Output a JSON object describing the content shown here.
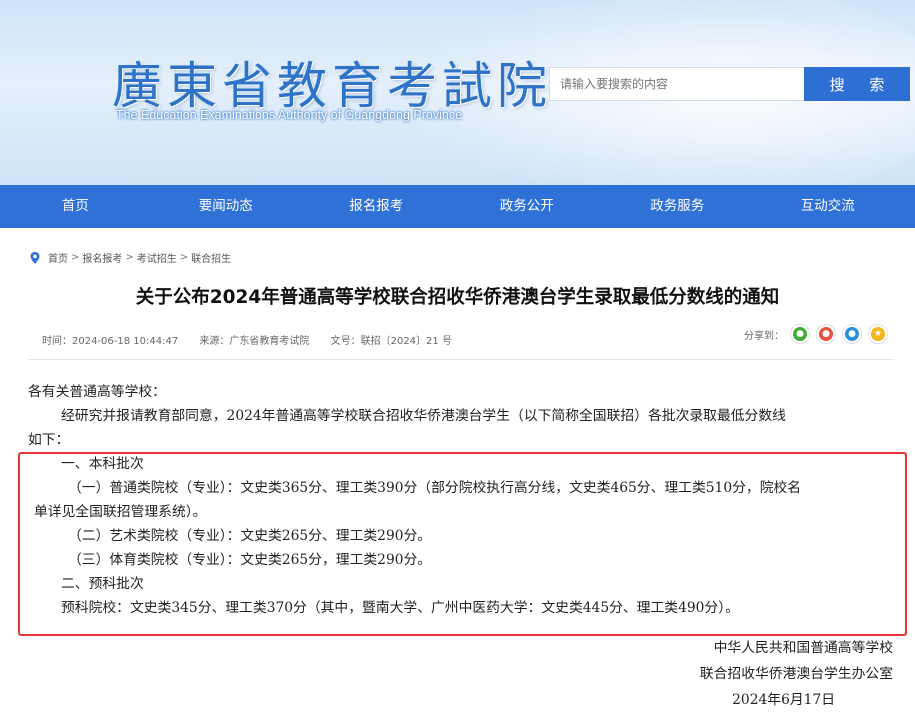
{
  "header": {
    "logo_cn": "廣東省教育考試院",
    "logo_en": "The Education Examinations Authority of Guangdong Province",
    "search_placeholder": "请输入要搜索的内容",
    "search_button": "搜 索"
  },
  "nav": {
    "items": [
      {
        "label": "首页"
      },
      {
        "label": "要闻动态"
      },
      {
        "label": "报名报考"
      },
      {
        "label": "政务公开"
      },
      {
        "label": "政务服务"
      },
      {
        "label": "互动交流"
      }
    ]
  },
  "breadcrumb": {
    "items": [
      "首页",
      "报名报考",
      "考试招生",
      "联合招生"
    ],
    "separator": ">"
  },
  "article": {
    "title": "关于公布2024年普通高等学校联合招收华侨港澳台学生录取最低分数线的通知",
    "meta": {
      "time": "时间：2024-06-18 10:44:47",
      "source": "来源：广东省教育考试院",
      "doc_no": "文号：联招〔2024〕21 号"
    },
    "share_label": "分享到：",
    "share_icons": [
      "wechat-icon",
      "weibo-icon",
      "qq-icon",
      "qzone-icon"
    ],
    "greeting": "各有关普通高等学校：",
    "intro_line1": "经研究并报请教育部同意，2024年普通高等学校联合招收华侨港澳台学生（以下简称全国联招）各批次录取最低分数线",
    "intro_line2": "如下：",
    "section1_title": "一、本科批次",
    "item1_line1": "（一）普通类院校（专业）：文史类365分、理工类390分（部分院校执行高分线，文史类465分、理工类510分，院校名",
    "item1_line2": "单详见全国联招管理系统）。",
    "item2": "（二）艺术类院校（专业）：文史类265分、理工类290分。",
    "item3": "（三）体育类院校（专业）：文史类265分，理工类290分。",
    "section2_title": "二、预科批次",
    "prep_line": "预科院校：文史类345分、理工类370分（其中，暨南大学、广州中医药大学：文史类445分、理工类490分）。",
    "sign_org1": "中华人民共和国普通高等学校",
    "sign_org2": "联合招收华侨港澳台学生办公室",
    "sign_date": "2024年6月17日"
  },
  "colors": {
    "nav_bg": "#2f71d6",
    "search_btn_bg": "#2d6fd3",
    "highlight_border": "#e53935",
    "logo": "#2f73c8"
  }
}
